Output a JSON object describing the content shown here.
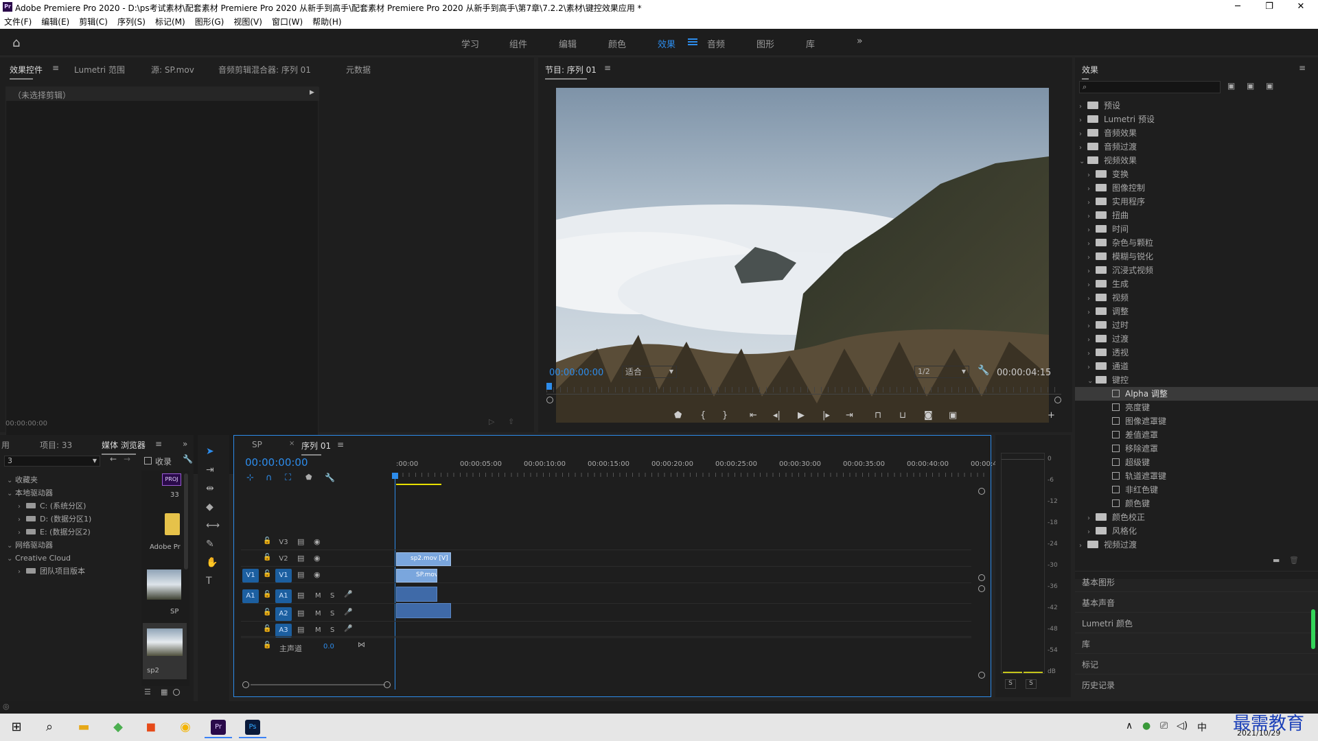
{
  "window": {
    "logo": "Pr",
    "title": "Adobe Premiere Pro 2020 - D:\\ps考试素材\\配套素材 Premiere Pro 2020 从新手到高手\\配套素材 Premiere Pro 2020 从新手到高手\\第7章\\7.2.2\\素材\\键控效果应用 *"
  },
  "menu": [
    "文件(F)",
    "编辑(E)",
    "剪辑(C)",
    "序列(S)",
    "标记(M)",
    "图形(G)",
    "视图(V)",
    "窗口(W)",
    "帮助(H)"
  ],
  "workspaces": [
    "学习",
    "组件",
    "编辑",
    "颜色",
    "效果",
    "音频",
    "图形",
    "库"
  ],
  "workspace_active": "效果",
  "source_panel": {
    "tabs": [
      "效果控件",
      "Lumetri 范围",
      "源: SP.mov",
      "音频剪辑混合器: 序列 01",
      "元数据"
    ],
    "no_clip": "（未选择剪辑）",
    "timecode": "00:00:00:00"
  },
  "program": {
    "title": "节目: 序列 01",
    "timecode": "00:00:00:00",
    "fit": "适合",
    "quality": "1/2",
    "duration": "00:00:04:15"
  },
  "effects": {
    "title": "效果",
    "search_placeholder": "",
    "items": [
      {
        "l": "预设",
        "d": 0,
        "o": false,
        "t": "bin"
      },
      {
        "l": "Lumetri 预设",
        "d": 0,
        "o": false,
        "t": "bin"
      },
      {
        "l": "音频效果",
        "d": 0,
        "o": false,
        "t": "fold"
      },
      {
        "l": "音频过渡",
        "d": 0,
        "o": false,
        "t": "fold"
      },
      {
        "l": "视频效果",
        "d": 0,
        "o": true,
        "t": "fold"
      },
      {
        "l": "变换",
        "d": 1,
        "o": false,
        "t": "fold"
      },
      {
        "l": "图像控制",
        "d": 1,
        "o": false,
        "t": "fold"
      },
      {
        "l": "实用程序",
        "d": 1,
        "o": false,
        "t": "fold"
      },
      {
        "l": "扭曲",
        "d": 1,
        "o": false,
        "t": "fold"
      },
      {
        "l": "时间",
        "d": 1,
        "o": false,
        "t": "fold"
      },
      {
        "l": "杂色与颗粒",
        "d": 1,
        "o": false,
        "t": "fold"
      },
      {
        "l": "模糊与锐化",
        "d": 1,
        "o": false,
        "t": "fold"
      },
      {
        "l": "沉浸式视频",
        "d": 1,
        "o": false,
        "t": "fold"
      },
      {
        "l": "生成",
        "d": 1,
        "o": false,
        "t": "fold"
      },
      {
        "l": "视频",
        "d": 1,
        "o": false,
        "t": "fold"
      },
      {
        "l": "调整",
        "d": 1,
        "o": false,
        "t": "fold"
      },
      {
        "l": "过时",
        "d": 1,
        "o": false,
        "t": "fold"
      },
      {
        "l": "过渡",
        "d": 1,
        "o": false,
        "t": "fold"
      },
      {
        "l": "透视",
        "d": 1,
        "o": false,
        "t": "fold"
      },
      {
        "l": "通道",
        "d": 1,
        "o": false,
        "t": "fold"
      },
      {
        "l": "键控",
        "d": 1,
        "o": true,
        "t": "fold"
      },
      {
        "l": "Alpha 调整",
        "d": 2,
        "o": false,
        "t": "fx",
        "sel": true
      },
      {
        "l": "亮度键",
        "d": 2,
        "o": false,
        "t": "fx"
      },
      {
        "l": "图像遮罩键",
        "d": 2,
        "o": false,
        "t": "fx"
      },
      {
        "l": "差值遮罩",
        "d": 2,
        "o": false,
        "t": "fx"
      },
      {
        "l": "移除遮罩",
        "d": 2,
        "o": false,
        "t": "fx"
      },
      {
        "l": "超级键",
        "d": 2,
        "o": false,
        "t": "fx"
      },
      {
        "l": "轨道遮罩键",
        "d": 2,
        "o": false,
        "t": "fx"
      },
      {
        "l": "非红色键",
        "d": 2,
        "o": false,
        "t": "fx"
      },
      {
        "l": "颜色键",
        "d": 2,
        "o": false,
        "t": "fx"
      },
      {
        "l": "颜色校正",
        "d": 1,
        "o": false,
        "t": "fold"
      },
      {
        "l": "风格化",
        "d": 1,
        "o": false,
        "t": "fold"
      },
      {
        "l": "视频过渡",
        "d": 0,
        "o": false,
        "t": "fold"
      }
    ]
  },
  "right_sections": [
    "基本图形",
    "基本声音",
    "Lumetri 颜色",
    "库",
    "标记",
    "历史记录"
  ],
  "project": {
    "tabs": [
      "用",
      "项目: 33",
      "媒体 浏览器"
    ],
    "filter": "3",
    "ingest": "收录",
    "tree": [
      "收藏夹",
      "本地驱动器",
      "C: (系统分区)",
      "D: (数据分区1)",
      "E: (数据分区2)",
      "网络驱动器",
      "Creative Cloud",
      "团队项目版本"
    ],
    "thumbs": [
      "33",
      "Adobe Pr",
      "SP",
      "sp2"
    ],
    "badge": "PROJ"
  },
  "timeline": {
    "tabs": [
      "SP",
      "序列 01"
    ],
    "timecode": "00:00:00:00",
    "ruler": [
      ":00:00",
      "00:00:05:00",
      "00:00:10:00",
      "00:00:15:00",
      "00:00:20:00",
      "00:00:25:00",
      "00:00:30:00",
      "00:00:35:00",
      "00:00:40:00",
      "00:00:4"
    ],
    "video_tracks": [
      "V3",
      "V2",
      "V1"
    ],
    "audio_tracks": [
      "A1",
      "A2",
      "A3"
    ],
    "src_v": "V1",
    "src_a": "A1",
    "mute": "M",
    "solo": "S",
    "master": "主声道",
    "master_val": "0.0",
    "clips": {
      "v2": "sp2.mov [V]",
      "v1": "SP.mov"
    }
  },
  "meter": {
    "scale": [
      "0",
      "-6",
      "-12",
      "-18",
      "-24",
      "-30",
      "-36",
      "-42",
      "-48",
      "-54",
      "dB"
    ],
    "solo": [
      "S",
      "S"
    ]
  },
  "taskbar": {
    "time": "中",
    "date": "2021/10/29",
    "watermark": "最需教育"
  }
}
